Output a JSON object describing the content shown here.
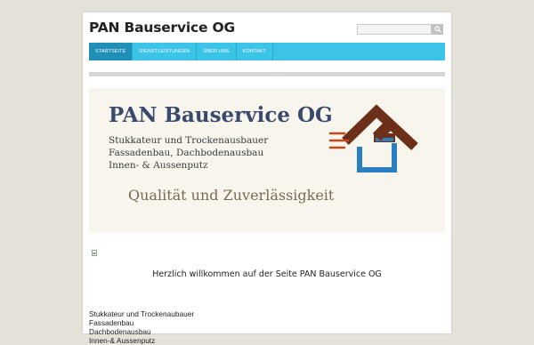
{
  "site": {
    "title": "PAN Bauservice OG"
  },
  "search": {
    "placeholder": ""
  },
  "nav": {
    "items": [
      {
        "label": "STARTSEITE"
      },
      {
        "label": "DIENSTLEISTUNGEN"
      },
      {
        "label": "ÜBER UNS"
      },
      {
        "label": "KONTAKT"
      }
    ]
  },
  "banner": {
    "title": "PAN Bauservice OG",
    "lines": [
      "Stukkateur und Trockenausbauer",
      "Fassadenbau, Dachbodenausbau",
      "Innen- & Aussenputz"
    ],
    "slogan": "Qualität und Zuverlässigkeit",
    "colors": {
      "roof": "#6b2f1a",
      "wall": "#2a7fc1",
      "stripes": "#c44a1c"
    }
  },
  "main": {
    "welcome": "Herzlich willkommen auf der Seite PAN Bauservice OG",
    "services": [
      "Stukkateur und Trockenaubauer",
      "Fassadenbau",
      "Dachbodenausbau",
      "Innen-& Aussenputz"
    ]
  },
  "colors": {
    "nav": "#3cc3e8",
    "nav_active": "#1f8fb8",
    "background": "#e4e1d9"
  }
}
